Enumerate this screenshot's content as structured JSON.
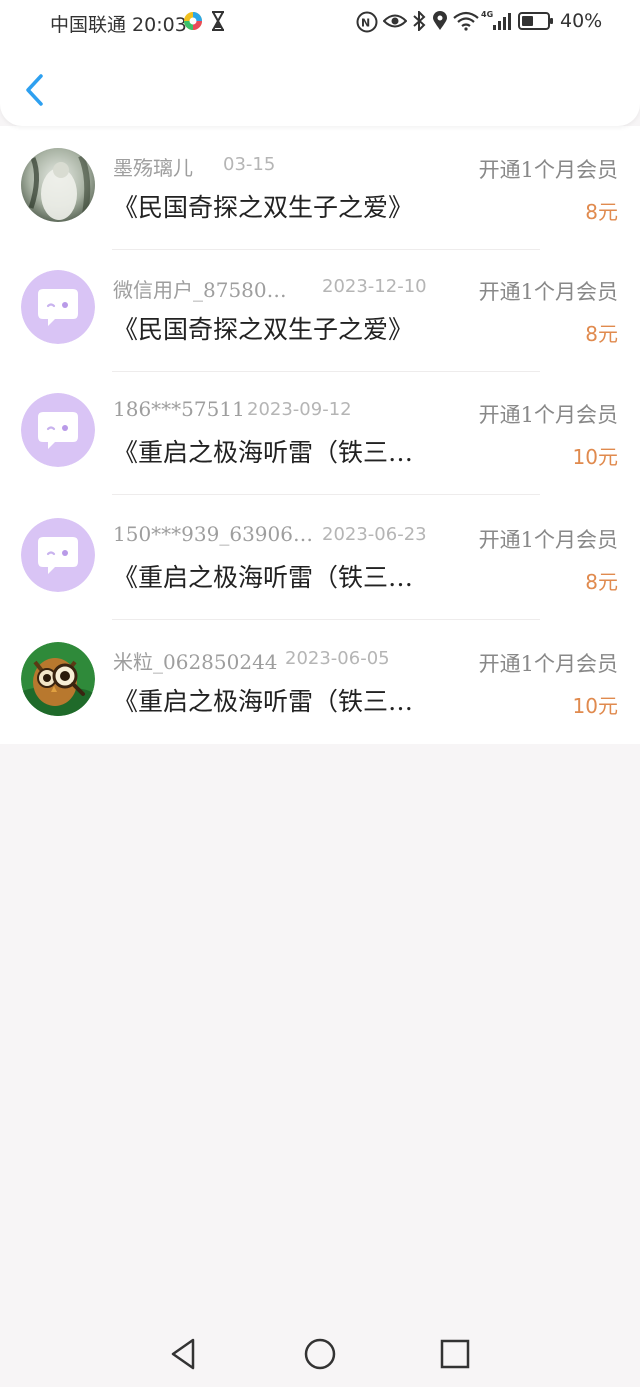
{
  "status_bar": {
    "carrier_time": "中国联通 20:03",
    "battery": "40%",
    "icons": [
      "colorful-app-icon",
      "hourglass-icon",
      "nfc-icon",
      "eye-icon",
      "bluetooth-icon",
      "location-icon",
      "wifi-icon",
      "signal-4g-icon",
      "battery-icon"
    ]
  },
  "header": {
    "back_icon": "chevron-left-icon",
    "accent_color": "#2ea0f0"
  },
  "records": [
    {
      "user": "墨殇璃儿",
      "date": "03-15",
      "title": "《民国奇探之双生子之爱》",
      "plan": "开通1个月会员",
      "price": "8元",
      "avatar": "photo"
    },
    {
      "user": "微信用户_87580…",
      "date": "2023-12-10",
      "title": "《民国奇探之双生子之爱》",
      "plan": "开通1个月会员",
      "price": "8元",
      "avatar": "default-chat-avatar"
    },
    {
      "user": "186***57511",
      "date": "2023-09-12",
      "title": "《重启之极海听雷（铁三…",
      "plan": "开通1个月会员",
      "price": "10元",
      "avatar": "default-chat-avatar"
    },
    {
      "user": "150***939_63906…",
      "date": "2023-06-23",
      "title": "《重启之极海听雷（铁三…",
      "plan": "开通1个月会员",
      "price": "8元",
      "avatar": "default-chat-avatar"
    },
    {
      "user": "米粒_062850244",
      "date": "2023-06-05",
      "title": "《重启之极海听雷（铁三…",
      "plan": "开通1个月会员",
      "price": "10元",
      "avatar": "detective-owl-avatar"
    }
  ],
  "colors": {
    "price": "#e08a4e",
    "avatar_purple": "#d9c4f5"
  },
  "navbar": {
    "icons": [
      "back-triangle-icon",
      "home-circle-icon",
      "recents-square-icon"
    ]
  }
}
